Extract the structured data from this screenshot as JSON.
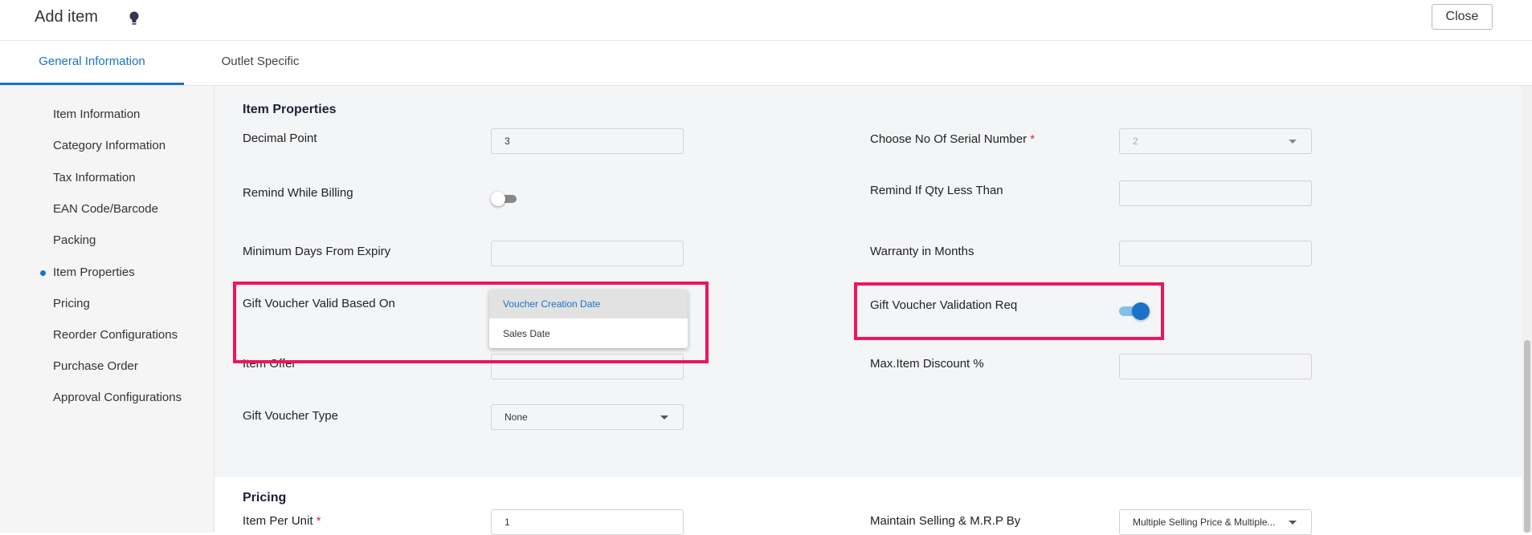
{
  "header": {
    "title": "Add item",
    "close_label": "Close"
  },
  "tabs": [
    {
      "label": "General Information",
      "active": true
    },
    {
      "label": "Outlet Specific",
      "active": false
    }
  ],
  "sidebar": {
    "items": [
      {
        "label": "Item Information"
      },
      {
        "label": "Category Information"
      },
      {
        "label": "Tax Information"
      },
      {
        "label": "EAN Code/Barcode"
      },
      {
        "label": "Packing"
      },
      {
        "label": "Item Properties",
        "active": true
      },
      {
        "label": "Pricing"
      },
      {
        "label": "Reorder Configurations"
      },
      {
        "label": "Purchase Order"
      },
      {
        "label": "Approval Configurations"
      }
    ]
  },
  "item_properties": {
    "title": "Item Properties",
    "decimal_point": {
      "label": "Decimal Point",
      "value": "3"
    },
    "serial_number": {
      "label": "Choose No Of Serial Number",
      "required_mark": "*",
      "value": "2"
    },
    "remind_billing": {
      "label": "Remind While Billing",
      "on": false
    },
    "remind_qty": {
      "label": "Remind If Qty Less Than",
      "value": ""
    },
    "min_days_expiry": {
      "label": "Minimum Days From Expiry",
      "value": ""
    },
    "warranty": {
      "label": "Warranty in Months",
      "value": ""
    },
    "gift_valid_based_on": {
      "label": "Gift Voucher Valid Based On",
      "options": [
        "Voucher Creation Date",
        "Sales Date"
      ],
      "highlighted": "Voucher Creation Date"
    },
    "gift_validation_req": {
      "label": "Gift Voucher Validation Req",
      "on": true
    },
    "item_offer": {
      "label": "Item Offer",
      "value": ""
    },
    "max_discount": {
      "label": "Max.Item Discount %",
      "value": ""
    },
    "gift_voucher_type": {
      "label": "Gift Voucher Type",
      "value": "None"
    }
  },
  "pricing": {
    "title": "Pricing",
    "item_per_unit": {
      "label": "Item Per Unit",
      "required_mark": "*",
      "value": "1"
    },
    "maintain_selling": {
      "label": "Maintain Selling & M.R.P By",
      "value": "Multiple Selling Price & Multiple..."
    }
  },
  "colors": {
    "accent": "#1a73c8",
    "highlight_box": "#f0145a",
    "required": "#e0243a"
  }
}
